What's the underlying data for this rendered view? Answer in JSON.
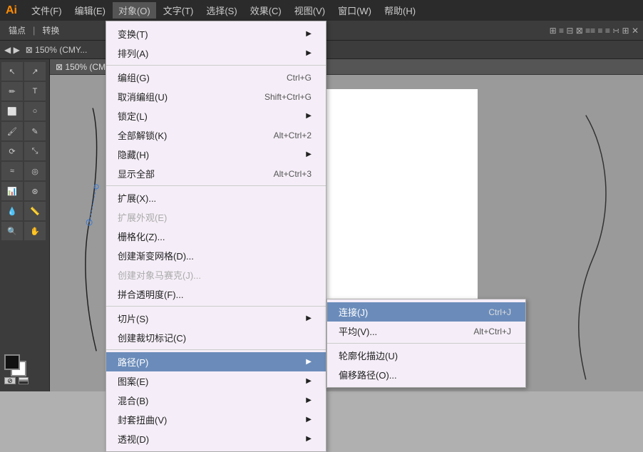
{
  "titleBar": {
    "logo": "Ai",
    "menuItems": [
      "文件(F)",
      "编辑(E)",
      "对象(O)",
      "文字(T)",
      "选择(S)",
      "效果(C)",
      "视图(V)",
      "窗口(W)",
      "帮助(H)"
    ]
  },
  "canvasTab": {
    "label": "150% (CMY..."
  },
  "objectMenu": {
    "items": [
      {
        "label": "变换(T)",
        "shortcut": "",
        "hasArrow": true,
        "disabled": false
      },
      {
        "label": "排列(A)",
        "shortcut": "",
        "hasArrow": true,
        "disabled": false
      },
      {
        "label": "",
        "isSeparator": true
      },
      {
        "label": "编组(G)",
        "shortcut": "Ctrl+G",
        "hasArrow": false,
        "disabled": false
      },
      {
        "label": "取消编组(U)",
        "shortcut": "Shift+Ctrl+G",
        "hasArrow": false,
        "disabled": false
      },
      {
        "label": "锁定(L)",
        "shortcut": "",
        "hasArrow": true,
        "disabled": false
      },
      {
        "label": "全部解锁(K)",
        "shortcut": "Alt+Ctrl+2",
        "hasArrow": false,
        "disabled": false
      },
      {
        "label": "隐藏(H)",
        "shortcut": "",
        "hasArrow": true,
        "disabled": false
      },
      {
        "label": "显示全部",
        "shortcut": "Alt+Ctrl+3",
        "hasArrow": false,
        "disabled": false
      },
      {
        "label": "",
        "isSeparator": true
      },
      {
        "label": "扩展(X)...",
        "shortcut": "",
        "hasArrow": false,
        "disabled": false
      },
      {
        "label": "扩展外观(E)",
        "shortcut": "",
        "hasArrow": false,
        "disabled": true
      },
      {
        "label": "栅格化(Z)...",
        "shortcut": "",
        "hasArrow": false,
        "disabled": false
      },
      {
        "label": "创建渐变网格(D)...",
        "shortcut": "",
        "hasArrow": false,
        "disabled": false
      },
      {
        "label": "创建对象马赛克(J)...",
        "shortcut": "",
        "hasArrow": false,
        "disabled": true
      },
      {
        "label": "拼合透明度(F)...",
        "shortcut": "",
        "hasArrow": false,
        "disabled": false
      },
      {
        "label": "",
        "isSeparator": true
      },
      {
        "label": "切片(S)",
        "shortcut": "",
        "hasArrow": true,
        "disabled": false
      },
      {
        "label": "创建裁切标记(C)",
        "shortcut": "",
        "hasArrow": false,
        "disabled": false
      },
      {
        "label": "",
        "isSeparator": true
      },
      {
        "label": "路径(P)",
        "shortcut": "",
        "hasArrow": true,
        "disabled": false,
        "highlighted": true
      },
      {
        "label": "图案(E)",
        "shortcut": "",
        "hasArrow": true,
        "disabled": false
      },
      {
        "label": "混合(B)",
        "shortcut": "",
        "hasArrow": true,
        "disabled": false
      },
      {
        "label": "封套扭曲(V)",
        "shortcut": "",
        "hasArrow": true,
        "disabled": false
      },
      {
        "label": "透视(D)",
        "shortcut": "",
        "hasArrow": true,
        "disabled": false
      }
    ]
  },
  "pathSubmenu": {
    "items": [
      {
        "label": "连接(J)",
        "shortcut": "Ctrl+J",
        "highlighted": true
      },
      {
        "label": "平均(V)...",
        "shortcut": "Alt+Ctrl+J",
        "highlighted": false
      },
      {
        "label": "",
        "isSeparator": true
      },
      {
        "label": "轮廓化描边(U)",
        "shortcut": "",
        "highlighted": false
      },
      {
        "label": "偏移路径(O)...",
        "shortcut": "",
        "highlighted": false
      }
    ]
  },
  "toolbarLeft": {
    "tools": [
      "↖",
      "⬚",
      "✏",
      "T",
      "⬜",
      "◎",
      "✂",
      "↔",
      "⟳",
      "◉",
      "📊",
      "⭕",
      "🔍",
      "✋"
    ]
  }
}
